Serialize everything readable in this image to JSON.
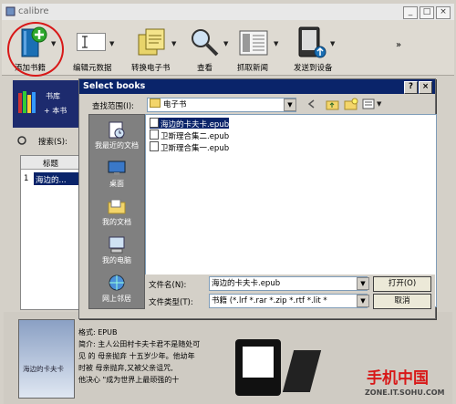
{
  "main": {
    "title": "calibre",
    "toolbar": [
      {
        "label": "添加书籍"
      },
      {
        "label": "编辑元数据"
      },
      {
        "label": "转换电子书"
      },
      {
        "label": "查看"
      },
      {
        "label": "抓取新闻"
      },
      {
        "label": "发送到设备"
      }
    ],
    "overflow": "»",
    "library": {
      "line1": "书库",
      "line2": "+ 本书"
    },
    "search_label": "搜索(S):",
    "table": {
      "header": "标题",
      "row_num": "1",
      "row_title": "海边的..."
    },
    "book_cover_title": "海边的卡夫卡",
    "details": {
      "line1": "格式: EPUB",
      "line2": "简介: 主人公田村卡夫卡君不是随处可",
      "line3": "见 的 母亲抛弃 十五岁少年。他幼年",
      "line4": "时被 母亲抛弃,又被父亲诅咒,",
      "line5": "他决心 \"成为世界上最顽强的十"
    }
  },
  "dialog": {
    "title": "Select books",
    "help": "?",
    "close": "×",
    "lookin_label": "查找范围(I):",
    "lookin_value": "电子书",
    "places": [
      "我最近的文档",
      "桌面",
      "我的文档",
      "我的电脑",
      "网上邻居"
    ],
    "files": [
      {
        "name": "海边的卡夫卡.epub",
        "selected": true
      },
      {
        "name": "卫斯理合集二.epub",
        "selected": false
      },
      {
        "name": "卫斯理合集一.epub",
        "selected": false
      }
    ],
    "filename_label": "文件名(N):",
    "filename_value": "海边的卡夫卡.epub",
    "filetype_label": "文件类型(T):",
    "filetype_value": "书籍 (*.lrf *.rar *.zip *.rtf *.lit *",
    "open_button": "打开(O)",
    "cancel_button": "取消"
  },
  "watermark": {
    "main": "手机中国",
    "sub": "ZONE.IT.SOHU.COM"
  },
  "colors": {
    "dialog_title": "#0a246a",
    "highlight": "#d81818",
    "library_bg": "#1d2b6e"
  }
}
